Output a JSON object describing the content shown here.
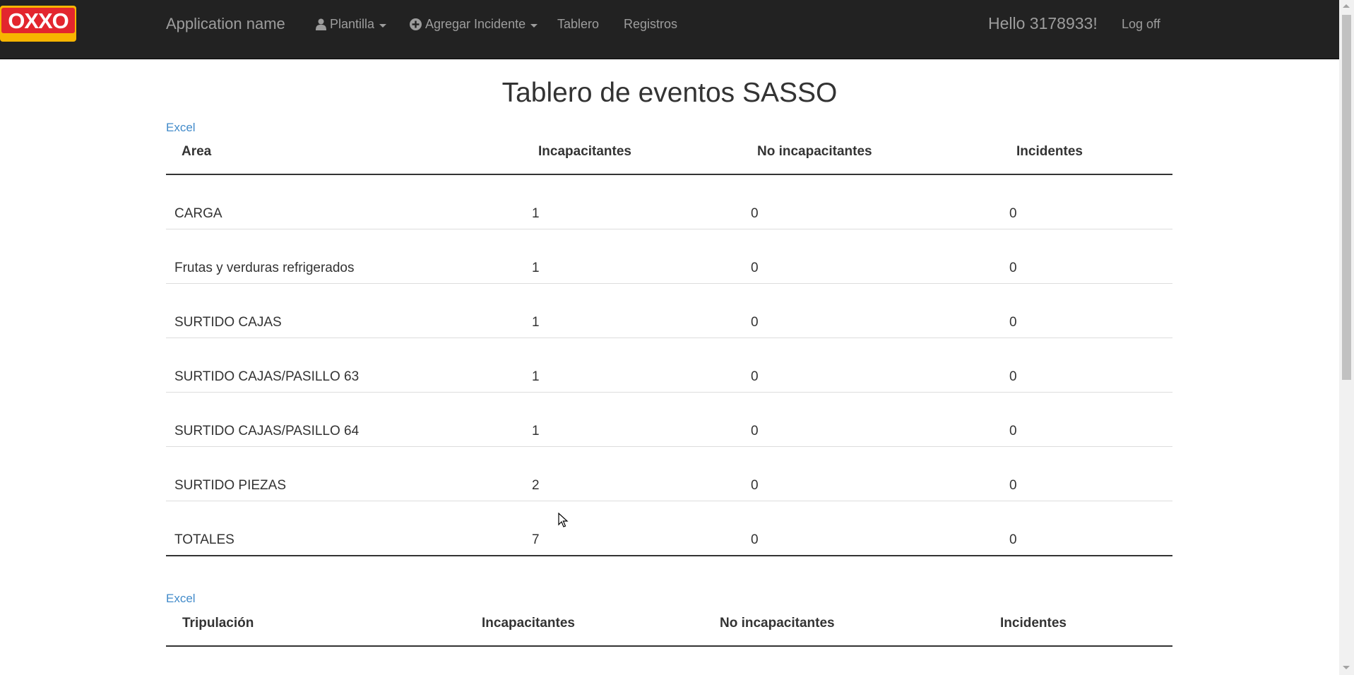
{
  "navbar": {
    "logo_text": "OXXO",
    "brand": "Application name",
    "items": [
      {
        "label": "Plantilla",
        "icon": "user-icon",
        "dropdown": true
      },
      {
        "label": "Agregar Incidente",
        "icon": "plus-circle-icon",
        "dropdown": true
      },
      {
        "label": "Tablero"
      },
      {
        "label": "Registros"
      }
    ],
    "greeting": "Hello 3178933!",
    "logoff": "Log off"
  },
  "page": {
    "title": "Tablero de eventos SASSO"
  },
  "area_table": {
    "excel_label": "Excel",
    "headers": [
      "Area",
      "Incapacitantes",
      "No incapacitantes",
      "Incidentes"
    ],
    "rows": [
      [
        "CARGA",
        "1",
        "0",
        "0"
      ],
      [
        "Frutas y verduras refrigerados",
        "1",
        "0",
        "0"
      ],
      [
        "SURTIDO CAJAS",
        "1",
        "0",
        "0"
      ],
      [
        "SURTIDO CAJAS/PASILLO 63",
        "1",
        "0",
        "0"
      ],
      [
        "SURTIDO CAJAS/PASILLO 64",
        "1",
        "0",
        "0"
      ],
      [
        "SURTIDO PIEZAS",
        "2",
        "0",
        "0"
      ],
      [
        "TOTALES",
        "7",
        "0",
        "0"
      ]
    ]
  },
  "crew_table": {
    "excel_label": "Excel",
    "headers": [
      "Tripulación",
      "Incapacitantes",
      "No incapacitantes",
      "Incidentes"
    ]
  },
  "colors": {
    "navbar_bg": "#222222",
    "nav_text": "#9d9d9d",
    "link": "#428bca",
    "logo_red": "#e3262e",
    "logo_yellow": "#f7b500"
  }
}
